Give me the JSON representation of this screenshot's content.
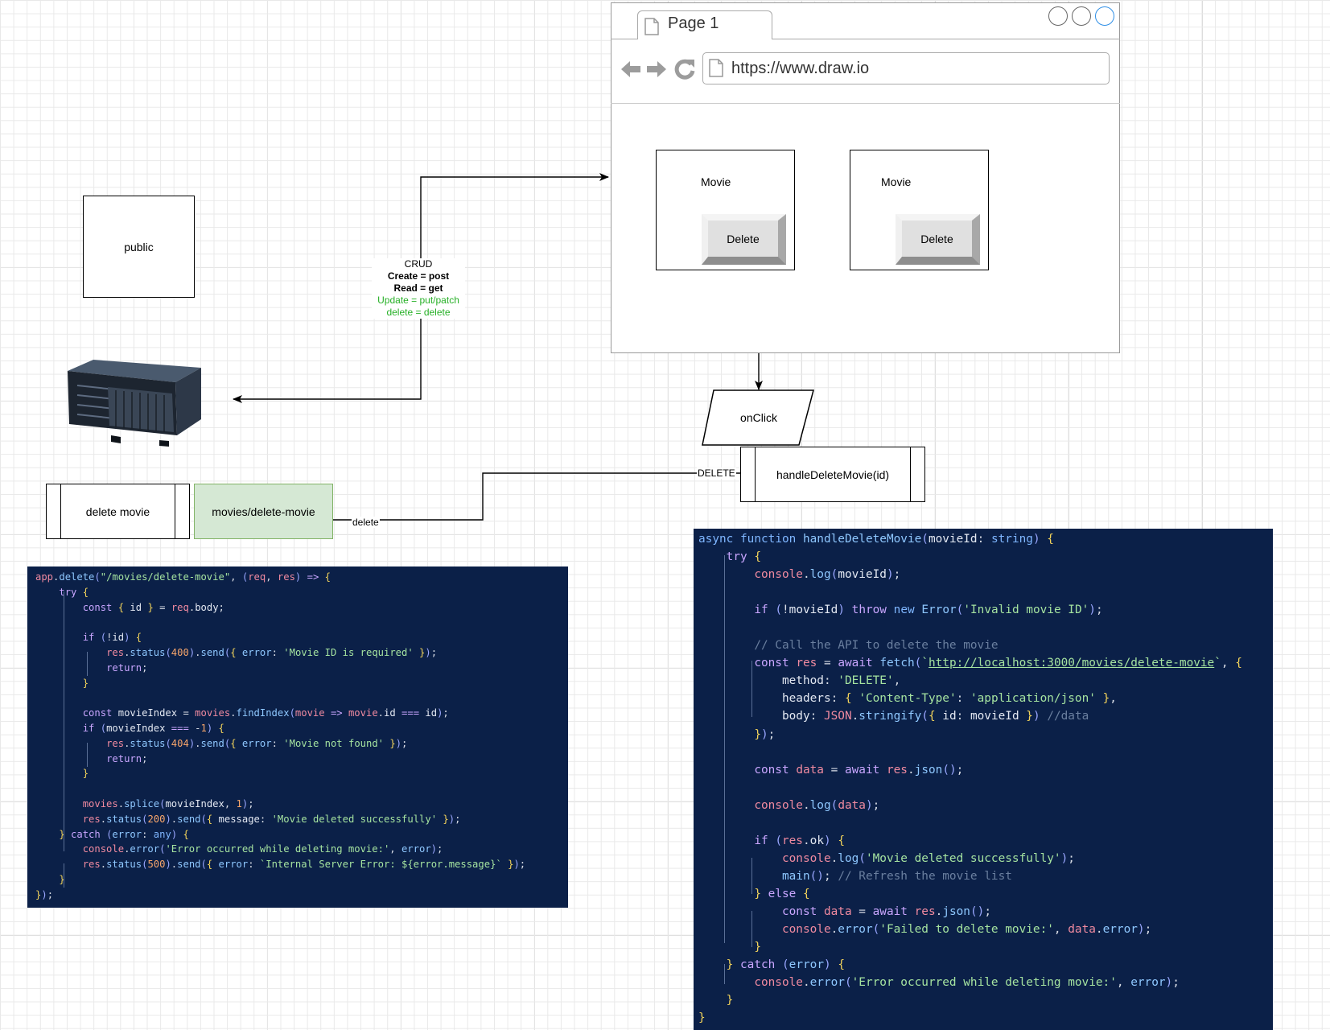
{
  "browser": {
    "tab_title": "Page 1",
    "url": "https://www.draw.io",
    "cards": [
      {
        "label": "Movie",
        "button": "Delete"
      },
      {
        "label": "Movie",
        "button": "Delete"
      }
    ]
  },
  "nodes": {
    "public": "public",
    "on_click": "onClick",
    "handle_delete": "handleDeleteMovie(id)",
    "delete_movie": "delete movie",
    "route": "movies/delete-movie"
  },
  "edges": {
    "crud": {
      "title": "CRUD",
      "create": "Create = post",
      "read": "Read = get",
      "update": "Update = put/patch",
      "delete": "delete = delete"
    },
    "delete_method": "DELETE",
    "delete_lower": "delete"
  },
  "colors": {
    "code_background": "#0b2048",
    "route_fill": "#d5e8d4",
    "route_stroke": "#82b366",
    "crud_green": "#26b026"
  },
  "code": {
    "server": [
      "app.delete(\"/movies/delete-movie\", (req, res) => {",
      "    try {",
      "        const { id } = req.body;",
      "",
      "        if (!id) {",
      "            res.status(400).send({ error: 'Movie ID is required' });",
      "            return;",
      "        }",
      "",
      "        const movieIndex = movies.findIndex(movie => movie.id === id);",
      "        if (movieIndex === -1) {",
      "            res.status(404).send({ error: 'Movie not found' });",
      "            return;",
      "        }",
      "",
      "        movies.splice(movieIndex, 1);",
      "        res.status(200).send({ message: 'Movie deleted successfully' });",
      "    } catch (error: any) {",
      "        console.error('Error occurred while deleting movie:', error);",
      "        res.status(500).send({ error: `Internal Server Error: ${error.message}` });",
      "    }",
      "});"
    ],
    "client": [
      "async function handleDeleteMovie(movieId: string) {",
      "    try {",
      "        console.log(movieId);",
      "",
      "        if (!movieId) throw new Error('Invalid movie ID');",
      "",
      "        // Call the API to delete the movie",
      "        const res = await fetch(`http://localhost:3000/movies/delete-movie`, {",
      "            method: 'DELETE',",
      "            headers: { 'Content-Type': 'application/json' },",
      "            body: JSON.stringify({ id: movieId }) //data",
      "        });",
      "",
      "        const data = await res.json();",
      "",
      "        console.log(data);",
      "",
      "        if (res.ok) {",
      "            console.log('Movie deleted successfully');",
      "            main(); // Refresh the movie list",
      "        } else {",
      "            const data = await res.json();",
      "            console.error('Failed to delete movie:', data.error);",
      "        }",
      "    } catch (error) {",
      "        console.error('Error occurred while deleting movie:', error);",
      "    }",
      "}"
    ]
  }
}
